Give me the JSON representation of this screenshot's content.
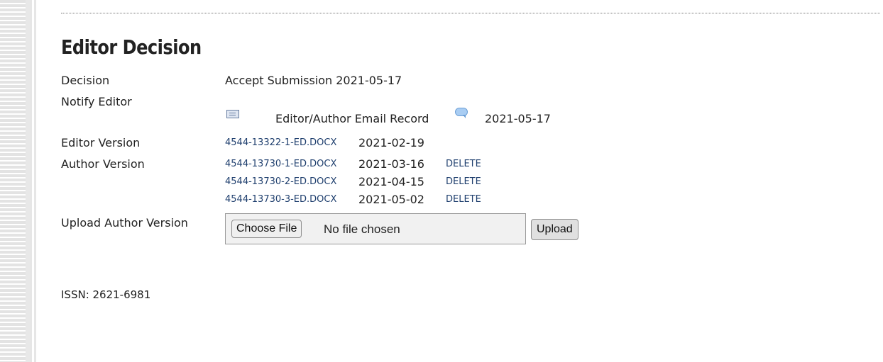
{
  "section": {
    "title": "Editor Decision"
  },
  "decision": {
    "label": "Decision",
    "value": "Accept Submission 2021-05-17"
  },
  "notify": {
    "label": "Notify Editor",
    "email_record_label": "Editor/Author Email Record",
    "date": "2021-05-17",
    "icons": [
      "mail-icon",
      "comment-bubble-icon"
    ]
  },
  "editor_version": {
    "label": "Editor Version",
    "file": "4544-13322-1-ED.DOCX",
    "date": "2021-02-19"
  },
  "author_version": {
    "label": "Author Version",
    "files": [
      {
        "file": "4544-13730-1-ED.DOCX",
        "date": "2021-03-16",
        "delete": "DELETE"
      },
      {
        "file": "4544-13730-2-ED.DOCX",
        "date": "2021-04-15",
        "delete": "DELETE"
      },
      {
        "file": "4544-13730-3-ED.DOCX",
        "date": "2021-05-02",
        "delete": "DELETE"
      }
    ]
  },
  "upload": {
    "label": "Upload Author Version",
    "choose_label": "Choose File",
    "no_file_text": "No file chosen",
    "upload_label": "Upload"
  },
  "footer": {
    "issn": "ISSN: 2621-6981"
  },
  "colors": {
    "link": "#1f3f6e",
    "text": "#222222"
  }
}
